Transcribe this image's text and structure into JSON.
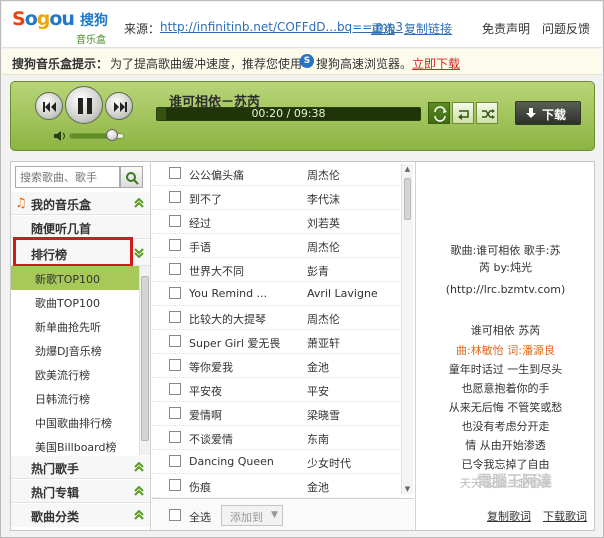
{
  "app": {
    "logo_text": "Sogou",
    "logo_cn": "搜狗",
    "logo_sub": "音乐盒"
  },
  "topbar": {
    "source_label": "来源：",
    "source_url": "http://infinitinb.net/COFFdD...bq==.mp3",
    "reselect": "重选",
    "copy_link": "复制链接",
    "disclaimer": "免责声明",
    "feedback": "问题反馈"
  },
  "tipbar": {
    "title": "搜狗音乐盒提示：",
    "text": "为了提高歌曲缓冲速度，推荐您使用",
    "browser": "搜狗高速浏览器。",
    "download": "立即下载"
  },
  "player": {
    "song_title": "谁可相依－苏芮",
    "time": "00:20 / 09:38",
    "progress": 0.035,
    "volume": 0.78,
    "download_label": "下载"
  },
  "sidebar": {
    "search_placeholder": "搜索歌曲、歌手",
    "my_box": "我的音乐盒",
    "random": "随便听几首",
    "charts": "排行榜",
    "chart_items": [
      "新歌TOP100",
      "歌曲TOP100",
      "新单曲抢先听",
      "劲爆DJ音乐榜",
      "欧美流行榜",
      "日韩流行榜",
      "中国歌曲排行榜",
      "美国Billboard榜"
    ],
    "hot_singers": "热门歌手",
    "hot_albums": "热门专辑",
    "song_categories": "歌曲分类"
  },
  "songs": [
    {
      "title": "公公偏头痛",
      "artist": "周杰伦"
    },
    {
      "title": "到不了",
      "artist": "李代沫"
    },
    {
      "title": "经过",
      "artist": "刘若英"
    },
    {
      "title": "手语",
      "artist": "周杰伦"
    },
    {
      "title": "世界大不同",
      "artist": "彭青"
    },
    {
      "title": "You Remind ...",
      "artist": "Avril Lavigne"
    },
    {
      "title": "比较大的大提琴",
      "artist": "周杰伦"
    },
    {
      "title": "Super Girl 爱无畏",
      "artist": "萧亚轩"
    },
    {
      "title": "等你爱我",
      "artist": "金池"
    },
    {
      "title": "平安夜",
      "artist": "平安"
    },
    {
      "title": "爱情啊",
      "artist": "梁晓雪"
    },
    {
      "title": "不谈爱情",
      "artist": "东南"
    },
    {
      "title": "Dancing Queen",
      "artist": "少女时代"
    },
    {
      "title": "伤痕",
      "artist": "金池"
    }
  ],
  "list_footer": {
    "select_all": "全选",
    "add_to": "添加到"
  },
  "lyrics": {
    "lines": [
      "歌曲:谁可相依  歌手:苏",
      "芮  by:炖光",
      "(http://lrc.bzmtv.com)",
      "",
      "谁可相依   苏芮",
      "曲:林敏怡  词:潘源良",
      "童年时话过  一生到尽头",
      "也愿意抱着你的手",
      "从来无后悔  不管笑或愁",
      "也没有考虑分开走",
      "情  从由开始渗透",
      "已令我忘掉了自由",
      "天天  没法一起留去"
    ],
    "copy": "复制歌词",
    "download": "下载歌词"
  },
  "colors": {
    "player_green": "#8cb443",
    "highlight_red": "#d11a1a",
    "link_blue": "#2c6fb6",
    "lyric_highlight": "#e0681a"
  }
}
